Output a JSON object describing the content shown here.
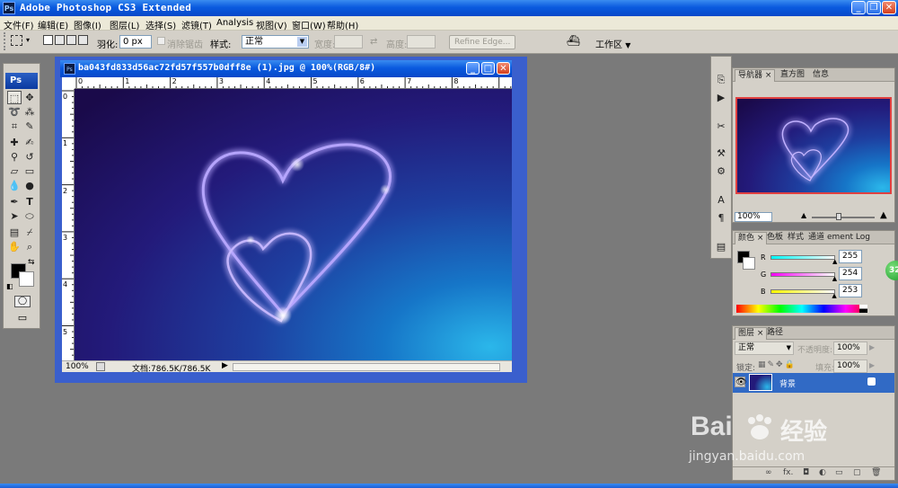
{
  "window": {
    "title": "Adobe Photoshop CS3 Extended",
    "app_icon": "Ps"
  },
  "menu": {
    "items": [
      "文件(F)",
      "编辑(E)",
      "图像(I)",
      "图层(L)",
      "选择(S)",
      "滤镜(T)",
      "Analysis",
      "视图(V)",
      "窗口(W)",
      "帮助(H)"
    ]
  },
  "options": {
    "feather_label": "羽化:",
    "feather_value": "0 px",
    "antialias_label": "消除锯齿",
    "style_label": "样式:",
    "style_value": "正常",
    "width_label": "宽度:",
    "height_label": "高度:",
    "refine_edge": "Refine Edge...",
    "workspace_label": "工作区"
  },
  "toolbox": {
    "logo": "Ps"
  },
  "document": {
    "title": "ba043fd833d56ac72fd57f557b0dff8e (1).jpg @ 100%(RGB/8#)",
    "icon": "Ps",
    "zoom": "100%",
    "doc_info": "文档:786.5K/786.5K",
    "hruler_labels": [
      "0",
      "1",
      "2",
      "3",
      "4",
      "5",
      "6",
      "7",
      "8"
    ],
    "vruler_labels": [
      "0",
      "1",
      "2",
      "3",
      "4",
      "5"
    ]
  },
  "navigator": {
    "tabs": [
      "导航器",
      "直方图",
      "信息"
    ],
    "zoom": "100%"
  },
  "color": {
    "tabs": [
      "颜色",
      "色板",
      "样式",
      "通道",
      "ement Log"
    ],
    "r_label": "R",
    "g_label": "G",
    "b_label": "B",
    "r_value": "255",
    "g_value": "254",
    "b_value": "253",
    "r_fraction": 1.0,
    "g_fraction": 0.996,
    "b_fraction": 0.992
  },
  "layers": {
    "tabs": [
      "图层",
      "路径"
    ],
    "blend_mode": "正常",
    "opacity_label": "不透明度:",
    "opacity_value": "100%",
    "lock_label": "锁定:",
    "fill_label": "填充:",
    "fill_value": "100%",
    "layer_name": "背景",
    "footer_fx": "fx."
  },
  "badge": {
    "value": "32"
  },
  "watermark": {
    "brand": "Bai",
    "brand2": "经验",
    "url": "jingyan.baidu.com"
  },
  "colors": {
    "titlebar": "#0a5adf",
    "panel_bg": "#d4d0c8",
    "workspace": "#7a7a7a",
    "layer_selected": "#316ac5",
    "doc_frame": "#3a5fcd"
  }
}
